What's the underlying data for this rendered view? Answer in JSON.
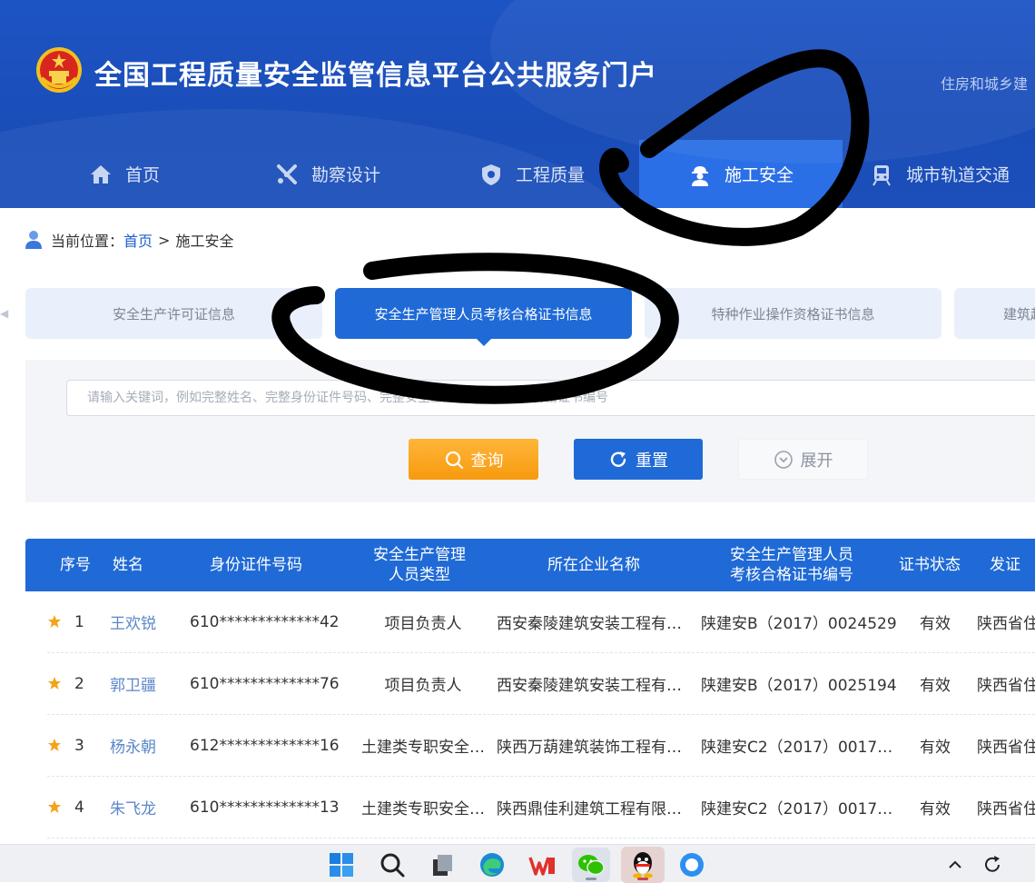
{
  "header": {
    "site_title": "全国工程质量安全监管信息平台公共服务门户",
    "ministry_link": "住房和城乡建",
    "nav": [
      {
        "label": "首页",
        "icon": "home-icon"
      },
      {
        "label": "勘察设计",
        "icon": "design-tools-icon"
      },
      {
        "label": "工程质量",
        "icon": "quality-shield-icon"
      },
      {
        "label": "施工安全",
        "icon": "worker-icon",
        "active": true
      },
      {
        "label": "城市轨道交通",
        "icon": "train-icon"
      }
    ]
  },
  "breadcrumb": {
    "prefix": "当前位置：",
    "home": "首页",
    "separator": ">",
    "current": "施工安全"
  },
  "tabs": [
    {
      "label": "安全生产许可证信息"
    },
    {
      "label": "安全生产管理人员考核合格证书信息",
      "active": true
    },
    {
      "label": "特种作业操作资格证书信息"
    },
    {
      "label": "建筑起"
    }
  ],
  "search": {
    "placeholder": "请输入关键词，例如完整姓名、完整身份证件号码、完整安全生产管理人员考核合格证书编号",
    "query_label": "查询",
    "reset_label": "重置",
    "expand_label": "展开"
  },
  "table": {
    "headers": {
      "index": "序号",
      "name": "姓名",
      "id": "身份证件号码",
      "type_line1": "安全生产管理",
      "type_line2": "人员类型",
      "company": "所在企业名称",
      "cert_line1": "安全生产管理人员",
      "cert_line2": "考核合格证书编号",
      "status": "证书状态",
      "issuer": "发证"
    },
    "rows": [
      {
        "index": "1",
        "name": "王欢锐",
        "id": "610*************42",
        "type": "项目负责人",
        "company": "西安秦陵建筑安装工程有…",
        "cert": "陕建安B（2017）0024529",
        "status": "有效",
        "issuer": "陕西省住"
      },
      {
        "index": "2",
        "name": "郭卫疆",
        "id": "610*************76",
        "type": "项目负责人",
        "company": "西安秦陵建筑安装工程有…",
        "cert": "陕建安B（2017）0025194",
        "status": "有效",
        "issuer": "陕西省住"
      },
      {
        "index": "3",
        "name": "杨永朝",
        "id": "612*************16",
        "type": "土建类专职安全…",
        "company": "陕西万葫建筑装饰工程有…",
        "cert": "陕建安C2（2017）0017…",
        "status": "有效",
        "issuer": "陕西省住"
      },
      {
        "index": "4",
        "name": "朱飞龙",
        "id": "610*************13",
        "type": "土建类专职安全…",
        "company": "陕西鼎佳利建筑工程有限…",
        "cert": "陕建安C2（2017）0017…",
        "status": "有效",
        "issuer": "陕西省住"
      }
    ]
  },
  "taskbar": {
    "icons": [
      "windows-start-icon",
      "search-icon",
      "task-view-icon",
      "edge-browser-icon",
      "wps-office-icon",
      "wechat-icon",
      "qq-icon",
      "app-icon"
    ],
    "tray": [
      "chevron-up-icon",
      "sync-icon"
    ]
  },
  "colors": {
    "header_blue": "#1d54c4",
    "nav_active": "#2b6fe6",
    "primary": "#1f6ad6",
    "query_orange": "#f79a0e",
    "link": "#1f5fcf"
  }
}
